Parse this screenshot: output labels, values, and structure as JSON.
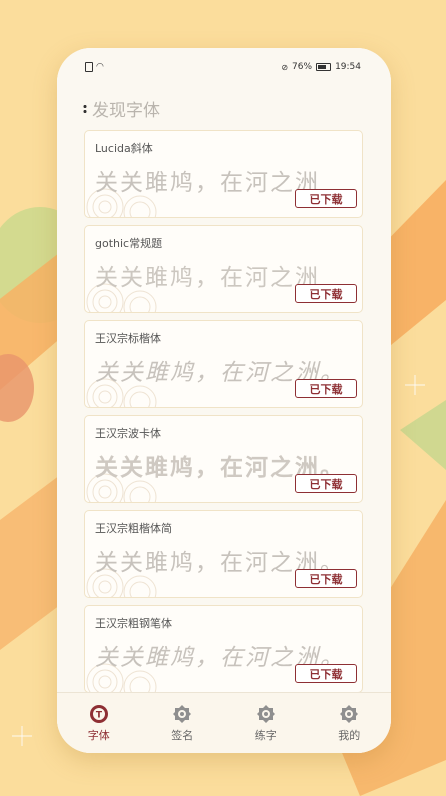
{
  "status_bar": {
    "left_icons": [
      "sim-icon",
      "wifi-icon"
    ],
    "battery_percent": "76%",
    "time": "19:54"
  },
  "header": {
    "title": "发现字体"
  },
  "fonts": [
    {
      "name": "Lucida斜体",
      "sample": "关关雎鸠，在河之洲",
      "button": "已下载"
    },
    {
      "name": "gothic常规题",
      "sample": "关关雎鸠，在河之洲",
      "button": "已下载"
    },
    {
      "name": "王汉宗标楷体",
      "sample": "关关雎鸠，在河之洲。",
      "button": "已下载"
    },
    {
      "name": "王汉宗波卡体",
      "sample": "关关雎鸠，在河之洲。",
      "button": "已下载"
    },
    {
      "name": "王汉宗粗楷体简",
      "sample": "关关雎鸠，在河之洲。",
      "button": "已下载"
    },
    {
      "name": "王汉宗粗钢笔体",
      "sample": "关关雎鸠，在河之洲。",
      "button": "已下载"
    }
  ],
  "tabbar": {
    "items": [
      {
        "label": "字体",
        "icon": "font-T-icon",
        "active": true
      },
      {
        "label": "签名",
        "icon": "signature-icon",
        "active": false
      },
      {
        "label": "练字",
        "icon": "practice-icon",
        "active": false
      },
      {
        "label": "我的",
        "icon": "profile-icon",
        "active": false
      }
    ]
  },
  "colors": {
    "background": "#fbdd9c",
    "accent": "#8e2f34",
    "shape_orange": "#f4a85c",
    "shape_green": "#bcd68a"
  }
}
